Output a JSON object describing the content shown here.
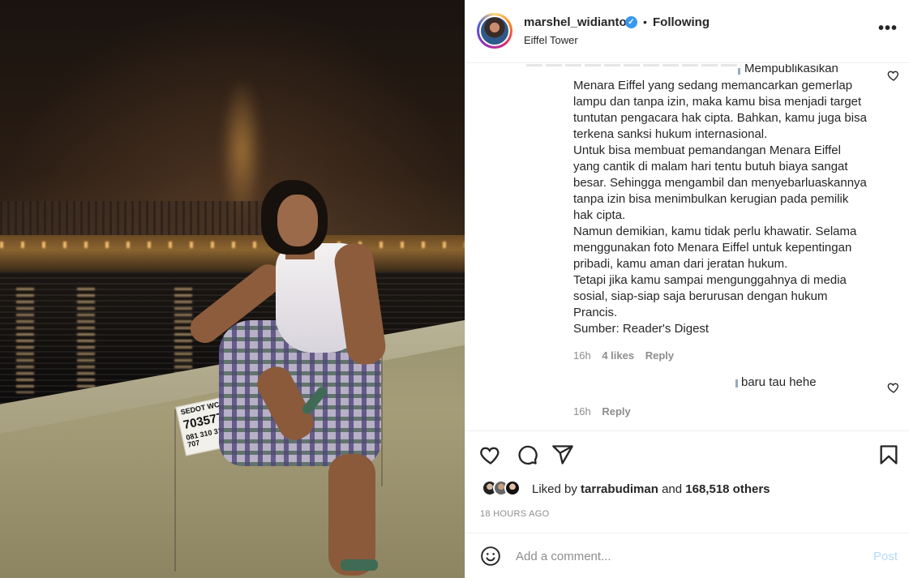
{
  "post": {
    "username": "marshel_widianto",
    "follow_status": "Following",
    "separator": "•",
    "location": "Eiffel Tower",
    "more_label": "•••"
  },
  "photo": {
    "sticker_line1": "SEDOT WC",
    "sticker_line2": "70357700",
    "sticker_line3": "081 310 310 707"
  },
  "comments": [
    {
      "first_line": "Mempublikasikan",
      "text": "Menara Eiffel yang sedang memancarkan gemerlap\nlampu dan tanpa izin, maka kamu bisa menjadi target\ntuntutan pengacara hak cipta. Bahkan, kamu juga bisa\nterkena sanksi hukum internasional.\nUntuk bisa membuat pemandangan Menara Eiffel\nyang cantik di malam hari tentu butuh biaya sangat\nbesar. Sehingga mengambil dan menyebarluaskannya\ntanpa izin bisa menimbulkan kerugian pada pemilik\nhak cipta.\nNamun demikian, kamu tidak perlu khawatir. Selama\nmenggunakan foto Menara Eiffel untuk kepentingan\npribadi, kamu aman dari jeratan hukum.\nTetapi jika kamu sampai mengunggahnya di media\nsosial, siap-siap saja berurusan dengan hukum\nPrancis.\nSumber: Reader's Digest",
      "time": "16h",
      "likes": "4 likes",
      "reply": "Reply"
    },
    {
      "text": "baru tau hehe",
      "time": "16h",
      "reply": "Reply"
    }
  ],
  "engagement": {
    "liked_by_prefix": "Liked by",
    "liked_by_user": "tarrabudiman",
    "and": "and",
    "others": "168,518 others",
    "time_ago": "18 HOURS AGO"
  },
  "add_comment": {
    "placeholder": "Add a comment...",
    "post_label": "Post"
  },
  "icons": [
    "heart-icon",
    "comment-icon",
    "share-icon",
    "bookmark-icon",
    "emoji-icon",
    "more-icon",
    "verified-icon"
  ],
  "colors": {
    "verified": "#3897f0",
    "post_disabled": "#b3dbff",
    "muted": "#8e8e8e",
    "text": "#262626"
  }
}
